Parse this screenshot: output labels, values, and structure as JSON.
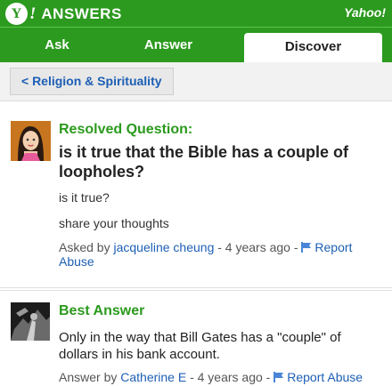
{
  "header": {
    "logo_symbol": "Y",
    "logo_bang": "!",
    "logo_text": "ANSWERS",
    "brand": "Yahoo!"
  },
  "tabs": [
    {
      "label": "Ask"
    },
    {
      "label": "Answer"
    },
    {
      "label": "Discover"
    }
  ],
  "breadcrumb": {
    "label": "< Religion & Spirituality"
  },
  "question": {
    "status": "Resolved Question:",
    "title": "is it true that the Bible has a couple of loopholes?",
    "details": [
      "is it true?",
      "share your thoughts"
    ],
    "asked_prefix": "Asked by ",
    "asker": "jacqueline cheung",
    "asked_time": " - 4 years ago - ",
    "report": "Report Abuse"
  },
  "best_answer": {
    "heading": "Best Answer",
    "text": "Only in the way that Bill Gates has a \"couple\" of dollars in his bank account.",
    "answered_prefix": "Answer by ",
    "answerer": "Catherine E",
    "answered_time": " - 4 years ago - ",
    "report": "Report Abuse"
  },
  "colors": {
    "brand_green": "#2b9a1e",
    "link_blue": "#1d5fb4",
    "flag_blue": "#4a86d8"
  },
  "icons": [
    "yahoo-logo-icon",
    "flag-icon",
    "user-avatar-icon"
  ]
}
